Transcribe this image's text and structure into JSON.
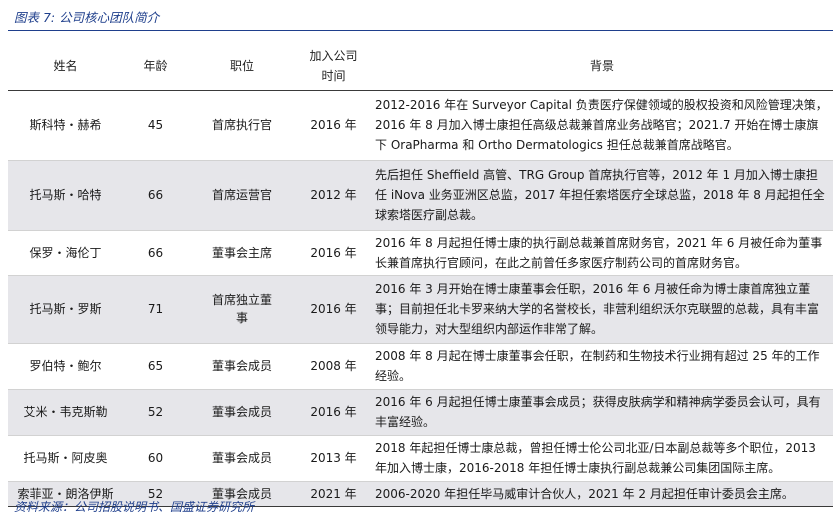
{
  "caption": "图表 7:  公司核心团队简介",
  "headers": {
    "name": "姓名",
    "age": "年龄",
    "position": "职位",
    "joined_line1": "加入公司",
    "joined_line2": "时间",
    "background": "背景"
  },
  "rows": [
    {
      "name": "斯科特・赫希",
      "age": "45",
      "position": "首席执行官",
      "joined": "2016 年",
      "background": "2012-2016 年在 Surveyor Capital 负责医疗保健领域的股权投资和风险管理决策，2016 年 8 月加入博士康担任高级总裁兼首席业务战略官；2021.7 开始在博士康旗下 OraPharma 和 Ortho Dermatologics 担任总裁兼首席战略官。"
    },
    {
      "name": "托马斯・哈特",
      "age": "66",
      "position": "首席运营官",
      "joined": "2012 年",
      "background": "先后担任 Sheffield 高管、TRG Group 首席执行官等，2012 年 1 月加入博士康担任 iNova 业务亚洲区总监，2017 年担任索塔医疗全球总监，2018 年 8 月起担任全球索塔医疗副总裁。"
    },
    {
      "name": "保罗・海伦丁",
      "age": "66",
      "position": "董事会主席",
      "joined": "2016 年",
      "background": "2016 年 8 月起担任博士康的执行副总裁兼首席财务官，2021 年 6 月被任命为董事长兼首席执行官顾问，在此之前曾任多家医疗制药公司的首席财务官。"
    },
    {
      "name": "托马斯・罗斯",
      "age": "71",
      "position_line1": "首席独立董",
      "position_line2": "事",
      "joined": "2016 年",
      "background": "2016 年 3 月开始在博士康董事会任职，2016 年 6 月被任命为博士康首席独立董事；目前担任北卡罗来纳大学的名誉校长，非营利组织沃尔克联盟的总裁，具有丰富领导能力，对大型组织内部运作非常了解。"
    },
    {
      "name": "罗伯特・鲍尔",
      "age": "65",
      "position": "董事会成员",
      "joined": "2008 年",
      "background": "2008 年 8 月起在博士康董事会任职，在制药和生物技术行业拥有超过 25 年的工作经验。"
    },
    {
      "name": "艾米・韦克斯勒",
      "age": "52",
      "position": "董事会成员",
      "joined": "2016 年",
      "background": "2016 年 6 月起担任博士康董事会成员；获得皮肤病学和精神病学委员会认可，具有丰富经验。"
    },
    {
      "name": "托马斯・阿皮奥",
      "age": "60",
      "position": "董事会成员",
      "joined": "2013 年",
      "background": "2018 年起担任博士康总裁，曾担任博士伦公司北亚/日本副总裁等多个职位，2013 年加入博士康，2016-2018 年担任博士康执行副总裁兼公司集团国际主席。"
    },
    {
      "name": "索菲亚・朗洛伊斯",
      "age": "52",
      "position": "董事会成员",
      "joined": "2021 年",
      "background": "2006-2020 年担任毕马威审计合伙人，2021 年 2 月起担任审计委员会主席。"
    }
  ],
  "source": "资料来源：公司招股说明书、国盛证券研究所"
}
